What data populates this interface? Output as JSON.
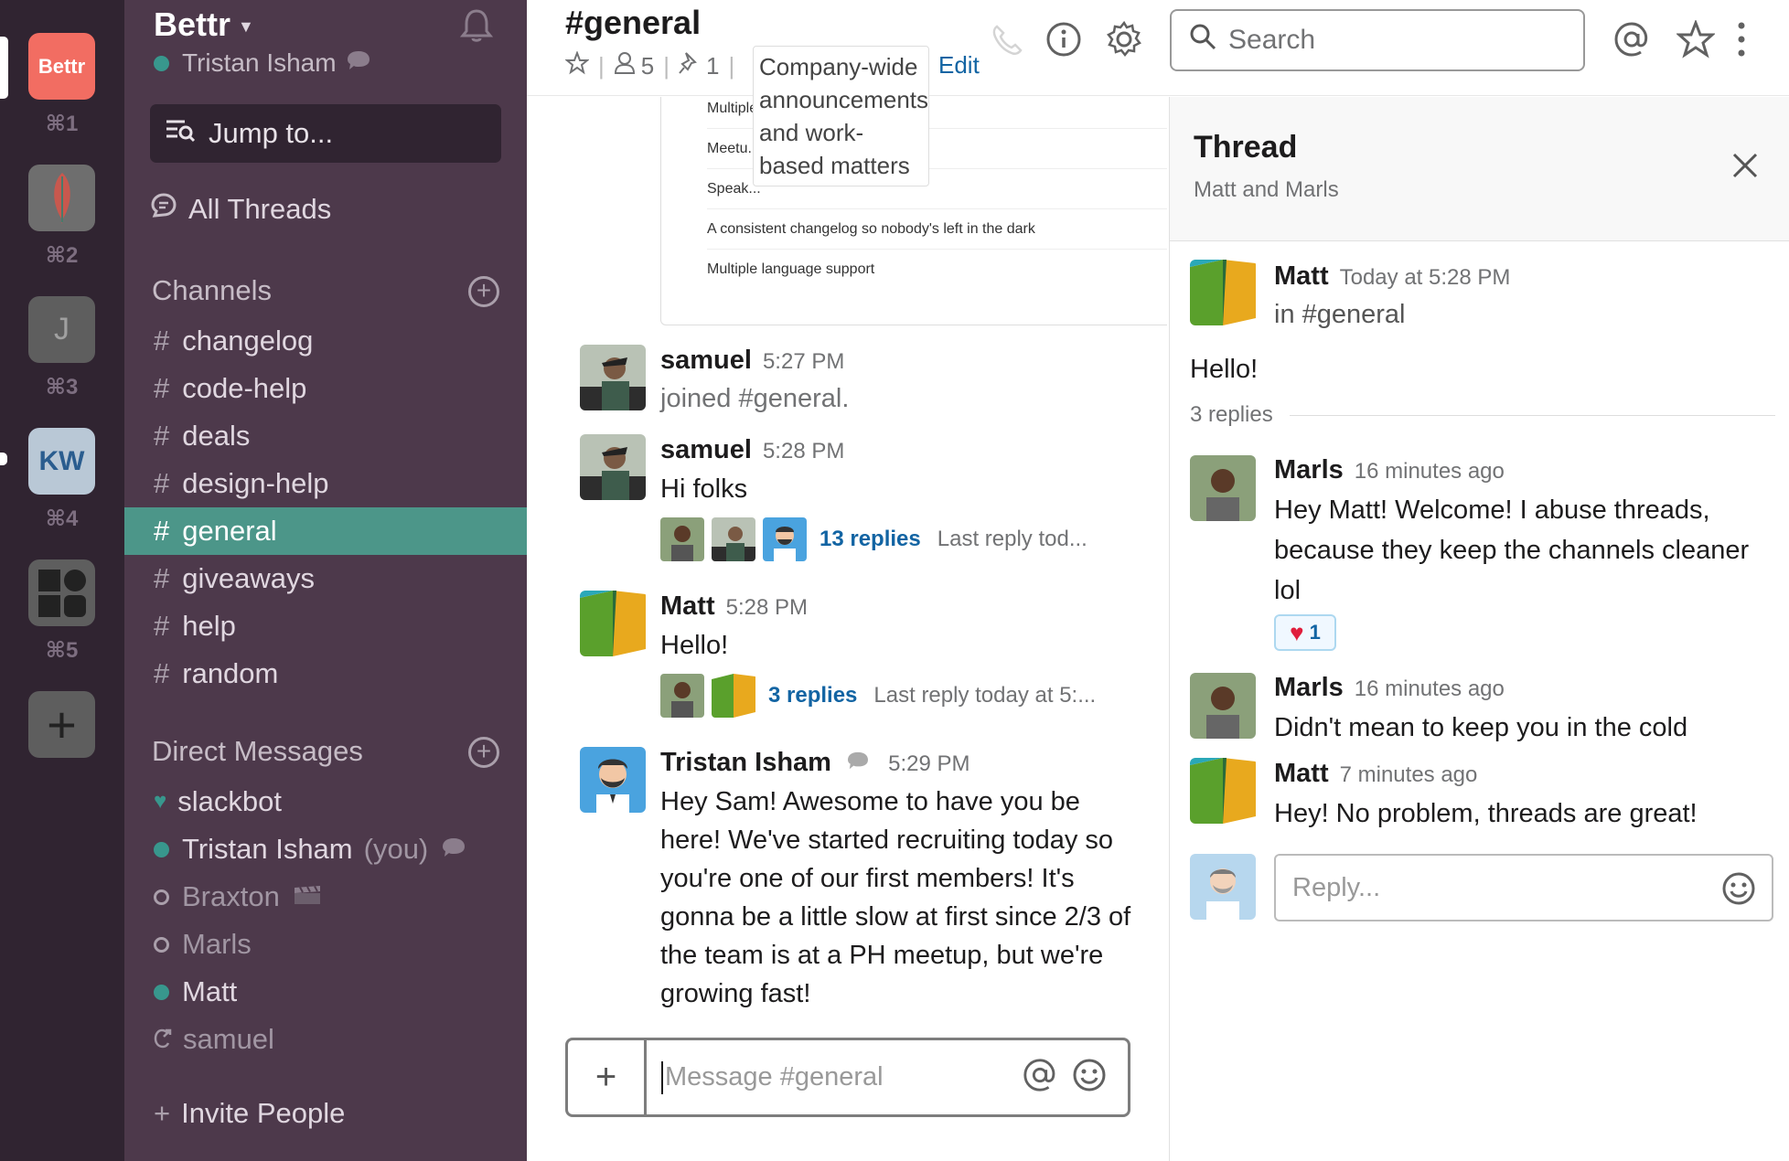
{
  "teams": [
    {
      "name": "Bettr",
      "shortcut": "⌘1",
      "color": "#f26d62"
    },
    {
      "name": "",
      "shortcut": "⌘2",
      "color": "#6e6e6e"
    },
    {
      "name": "J",
      "shortcut": "⌘3",
      "color": "#5e5e5e"
    },
    {
      "name": "KW",
      "shortcut": "⌘4",
      "color": "#b9c8d6"
    },
    {
      "name": "",
      "shortcut": "⌘5",
      "color": "#5e5e5e"
    }
  ],
  "sidebar": {
    "team_name": "Bettr",
    "user_name": "Tristan Isham",
    "jump_label": "Jump to...",
    "all_threads_label": "All Threads",
    "channels_heading": "Channels",
    "channels": [
      "changelog",
      "code-help",
      "deals",
      "design-help",
      "general",
      "giveaways",
      "help",
      "random"
    ],
    "active_channel": "general",
    "dm_heading": "Direct Messages",
    "dms": [
      {
        "name": "slackbot",
        "status": "heart"
      },
      {
        "name": "Tristan Isham",
        "suffix": "(you)",
        "status": "online"
      },
      {
        "name": "Braxton",
        "status": "away"
      },
      {
        "name": "Marls",
        "status": "away"
      },
      {
        "name": "Matt",
        "status": "online"
      },
      {
        "name": "samuel",
        "status": "shared"
      }
    ],
    "invite_label": "Invite People"
  },
  "header": {
    "channel": "#general",
    "members": "5",
    "pinned": "1",
    "purpose": "Company-wide announcements and work-based matters",
    "edit_label": "Edit",
    "search_placeholder": "Search"
  },
  "attachment_rows": [
    "Multiple ... ions",
    "Meetu...",
    "Speak...",
    "A consistent changelog so nobody's left in the dark",
    "Multiple language support"
  ],
  "messages": [
    {
      "user": "samuel",
      "time": "5:27 PM",
      "text": "joined #general."
    },
    {
      "user": "samuel",
      "time": "5:28 PM",
      "text": "Hi folks",
      "replies": "13 replies",
      "last_reply": "Last reply tod..."
    },
    {
      "user": "Matt",
      "time": "5:28 PM",
      "text": "Hello!",
      "replies": "3 replies",
      "last_reply": "Last reply today at 5:..."
    },
    {
      "user": "Tristan Isham",
      "time": "5:29 PM",
      "text": "Hey Sam! Awesome to have you be here! We've started recruiting today so you're one of our first members! It's gonna be a little slow at first since 2/3 of the team is at a PH meetup, but we're growing fast!"
    }
  ],
  "composer_placeholder": "Message #general",
  "thread": {
    "title": "Thread",
    "subtitle": "Matt and Marls",
    "parent": {
      "user": "Matt",
      "time": "Today at 5:28 PM",
      "channel": "in #general",
      "text": "Hello!"
    },
    "reply_count": "3 replies",
    "replies": [
      {
        "user": "Marls",
        "time": "16 minutes ago",
        "text": "Hey Matt! Welcome! I abuse threads, because they keep the channels cleaner lol",
        "reaction_count": "1"
      },
      {
        "user": "Marls",
        "time": "16 minutes ago",
        "text": "Didn't mean to keep you in the cold"
      },
      {
        "user": "Matt",
        "time": "7 minutes ago",
        "text": "Hey! No problem, threads are great!"
      }
    ],
    "reply_placeholder": "Reply..."
  },
  "colors": {
    "sidebar": "#4d394b",
    "team_bar": "#302431",
    "active": "#4c9689",
    "link": "#1264a3"
  }
}
